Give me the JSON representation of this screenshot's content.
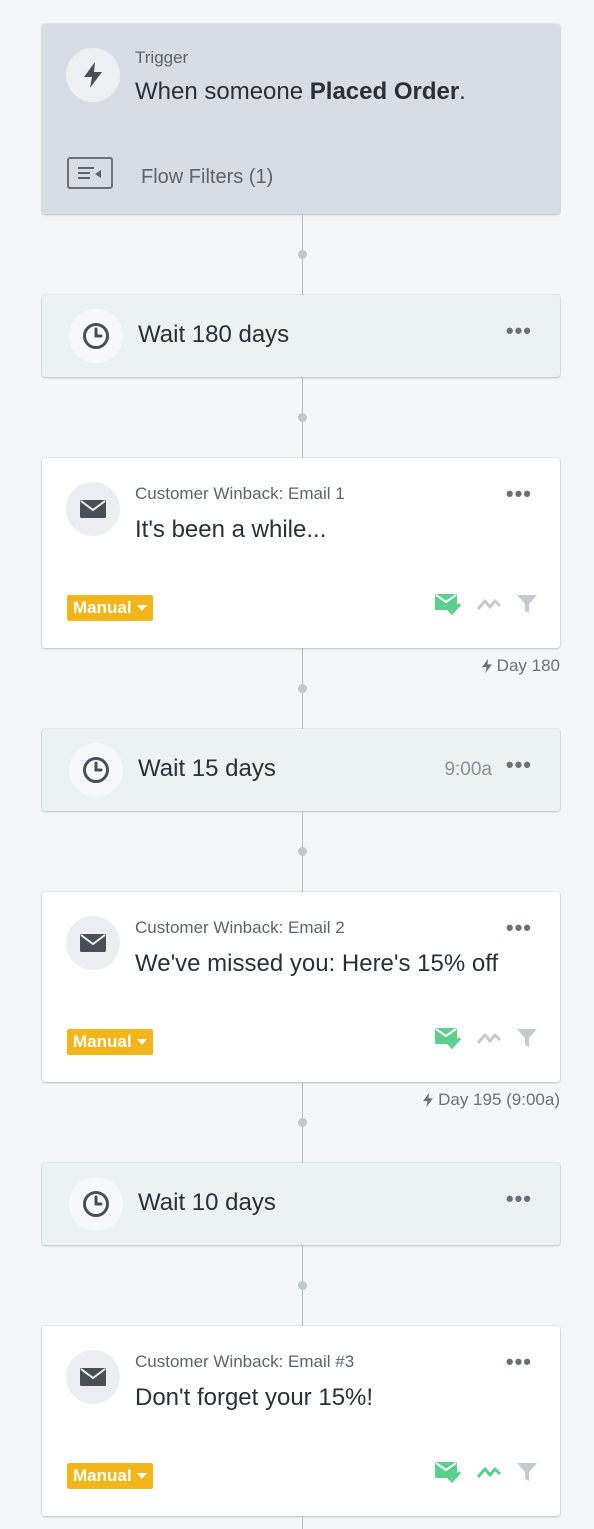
{
  "trigger": {
    "label": "Trigger",
    "text_prefix": "When someone ",
    "text_bold": "Placed Order",
    "text_suffix": ".",
    "icon": "lightning-icon",
    "filters_label": "Flow Filters (1)",
    "filters_icon": "filter-list-icon"
  },
  "steps": [
    {
      "type": "wait",
      "label": "Wait 180 days",
      "time": "",
      "icon": "clock-icon"
    },
    {
      "type": "email",
      "name": "Customer Winback: Email 1",
      "subject": "It's been a while...",
      "status": "Manual",
      "icon": "envelope-icon",
      "day_label": "Day 180",
      "smart_sending_active": true,
      "ab_active": false
    },
    {
      "type": "wait",
      "label": "Wait 15 days",
      "time": "9:00a",
      "icon": "clock-icon"
    },
    {
      "type": "email",
      "name": "Customer Winback: Email 2",
      "subject": "We've missed you: Here's 15% off",
      "status": "Manual",
      "icon": "envelope-icon",
      "day_label": "Day 195 (9:00a)",
      "smart_sending_active": true,
      "ab_active": false
    },
    {
      "type": "wait",
      "label": "Wait 10 days",
      "time": "",
      "icon": "clock-icon"
    },
    {
      "type": "email",
      "name": "Customer Winback: Email #3",
      "subject": "Don't forget your 15%!",
      "status": "Manual",
      "icon": "envelope-icon",
      "day_label": "",
      "smart_sending_active": true,
      "ab_active": true
    }
  ],
  "more_label": "•••",
  "colors": {
    "trigger_bg": "#d8dde5",
    "wait_bg": "#ecf1f2",
    "manual_badge": "#f2b61a",
    "active_green": "#5ccf8c",
    "inactive_gray": "#c6cad0"
  }
}
